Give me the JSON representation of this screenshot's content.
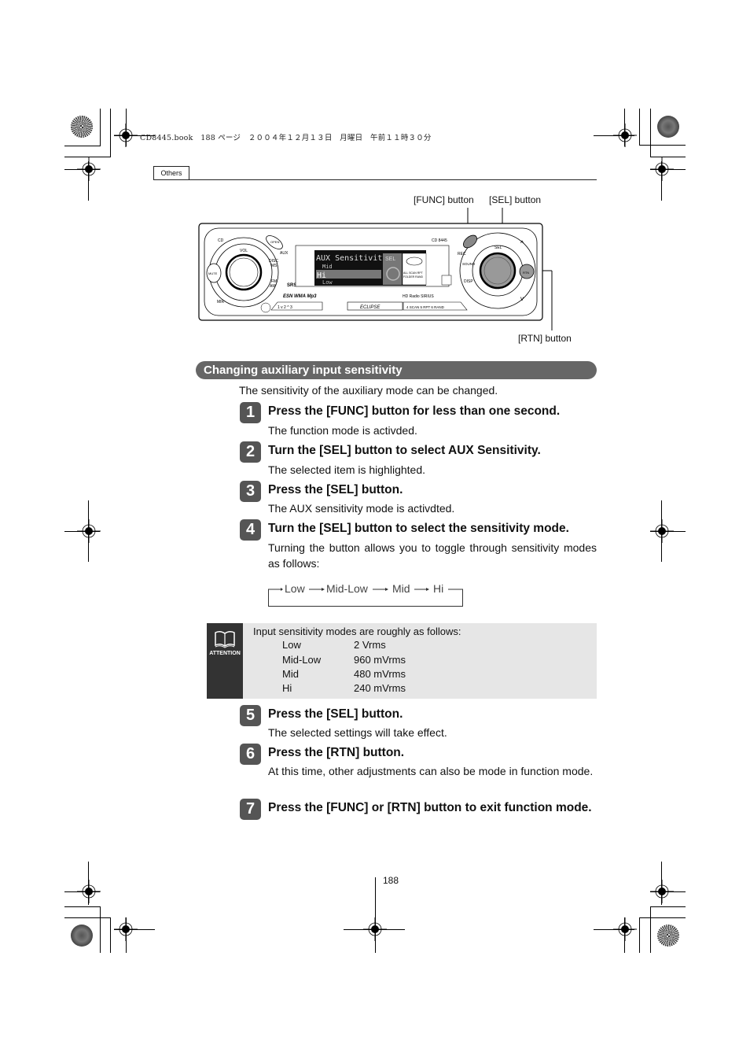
{
  "print_header": {
    "text": "CD8445.book　188 ページ　２００４年１２月１３日　月曜日　午前１１時３０分"
  },
  "section_tab": "Others",
  "figure": {
    "callouts": {
      "func": "[FUNC] button",
      "sel": "[SEL] button",
      "rtn": "[RTN] button"
    },
    "device": {
      "model": "CD 8445",
      "brand": "ECLIPSE",
      "display": {
        "title": "AUX Sensitivity",
        "items": [
          "Mid",
          "Hi",
          "Low"
        ],
        "selected": "Hi",
        "sel_tag": "SEL"
      },
      "left_buttons": [
        "CD",
        "OPEN",
        "AUX",
        "VOL",
        "DISC MS",
        "FM AM",
        "MUTE",
        "MIR"
      ],
      "right_buttons": [
        "FUNC",
        "REC",
        "SOUND",
        "DISP",
        "SEL",
        "RTN"
      ],
      "presets": [
        "1",
        "2",
        "3",
        "4 SCAN",
        "5 RPT",
        "6 RAND"
      ],
      "logos": [
        "ESN",
        "WMA",
        "MP3",
        "SRS",
        "HD Radio",
        "SIRIUS READY"
      ]
    }
  },
  "section": {
    "title": "Changing auxiliary input sensitivity",
    "intro": "The sensitivity of the auxiliary mode can be changed.",
    "steps": [
      {
        "num": "1",
        "title": "Press the [FUNC] button for less than one second.",
        "desc": "The function mode is activded."
      },
      {
        "num": "2",
        "title": "Turn the [SEL] button to select AUX Sensitivity.",
        "desc": "The selected item is highlighted."
      },
      {
        "num": "3",
        "title": "Press the [SEL] button.",
        "desc": "The AUX sensitivity mode is activdted."
      },
      {
        "num": "4",
        "title": "Turn the [SEL] button to select the sensitivity mode.",
        "desc": "Turning the button allows you to toggle through sensitivity modes as follows:"
      },
      {
        "num": "5",
        "title": "Press the [SEL] button.",
        "desc": "The selected settings will take effect."
      },
      {
        "num": "6",
        "title": "Press the [RTN] button.",
        "desc": "At this time, other adjustments can also be mode in function mode."
      },
      {
        "num": "7",
        "title": "Press the [FUNC] or [RTN] button to exit function mode.",
        "desc": ""
      }
    ],
    "cycle": [
      "Low",
      "Mid-Low",
      "Mid",
      "Hi"
    ]
  },
  "attention": {
    "label": "ATTENTION",
    "icon": "book-icon",
    "intro": "Input sensitivity modes are roughly as follows:",
    "rows": [
      {
        "mode": "Low",
        "value": "2 Vrms"
      },
      {
        "mode": "Mid-Low",
        "value": "960 mVrms"
      },
      {
        "mode": "Mid",
        "value": "480 mVrms"
      },
      {
        "mode": "Hi",
        "value": "240 mVrms"
      }
    ]
  },
  "page_number": "188"
}
